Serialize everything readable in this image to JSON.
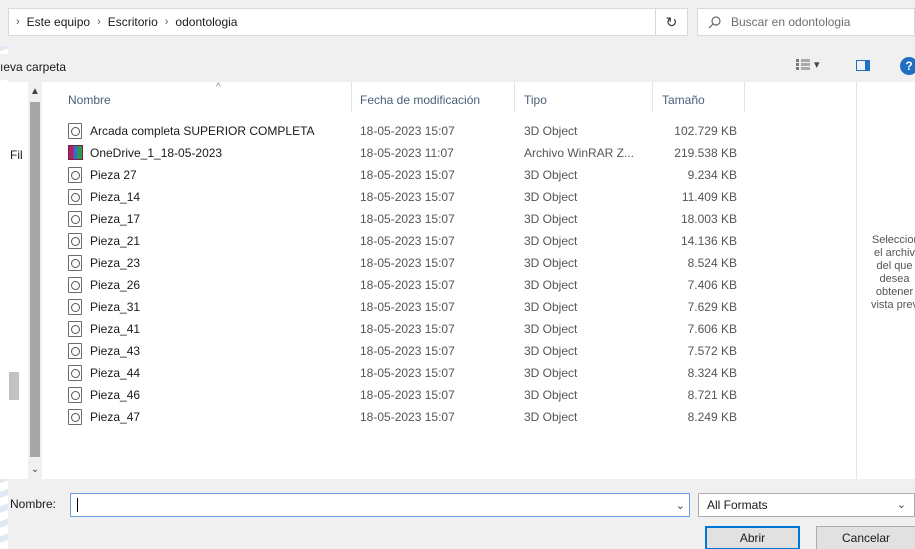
{
  "address": {
    "crumbs": [
      "Este equipo",
      "Escritorio",
      "odontologia"
    ],
    "dropdown_icon": "chevron-down-icon",
    "refresh_icon": "refresh-icon"
  },
  "search": {
    "placeholder": "Buscar en odontologia"
  },
  "toolbar": {
    "new_folder_label": "ıeva carpeta",
    "view_icon": "view-options-icon",
    "preview_icon": "preview-pane-icon",
    "help_label": "?"
  },
  "nav": {
    "label": "Fil"
  },
  "columns": {
    "name": "Nombre",
    "date": "Fecha de modificación",
    "type": "Tipo",
    "size": "Tamaño"
  },
  "files": [
    {
      "name": "Arcada completa SUPERIOR COMPLETA",
      "date": "18-05-2023 15:07",
      "type": "3D Object",
      "size": "102.729 KB",
      "icon": "3d-object-icon"
    },
    {
      "name": "OneDrive_1_18-05-2023",
      "date": "18-05-2023 11:07",
      "type": "Archivo WinRAR Z...",
      "size": "219.538 KB",
      "icon": "winrar-icon"
    },
    {
      "name": "Pieza 27",
      "date": "18-05-2023 15:07",
      "type": "3D Object",
      "size": "9.234 KB",
      "icon": "3d-object-icon"
    },
    {
      "name": "Pieza_14",
      "date": "18-05-2023 15:07",
      "type": "3D Object",
      "size": "11.409 KB",
      "icon": "3d-object-icon"
    },
    {
      "name": "Pieza_17",
      "date": "18-05-2023 15:07",
      "type": "3D Object",
      "size": "18.003 KB",
      "icon": "3d-object-icon"
    },
    {
      "name": "Pieza_21",
      "date": "18-05-2023 15:07",
      "type": "3D Object",
      "size": "14.136 KB",
      "icon": "3d-object-icon"
    },
    {
      "name": "Pieza_23",
      "date": "18-05-2023 15:07",
      "type": "3D Object",
      "size": "8.524 KB",
      "icon": "3d-object-icon"
    },
    {
      "name": "Pieza_26",
      "date": "18-05-2023 15:07",
      "type": "3D Object",
      "size": "7.406 KB",
      "icon": "3d-object-icon"
    },
    {
      "name": "Pieza_31",
      "date": "18-05-2023 15:07",
      "type": "3D Object",
      "size": "7.629 KB",
      "icon": "3d-object-icon"
    },
    {
      "name": "Pieza_41",
      "date": "18-05-2023 15:07",
      "type": "3D Object",
      "size": "7.606 KB",
      "icon": "3d-object-icon"
    },
    {
      "name": "Pieza_43",
      "date": "18-05-2023 15:07",
      "type": "3D Object",
      "size": "7.572 KB",
      "icon": "3d-object-icon"
    },
    {
      "name": "Pieza_44",
      "date": "18-05-2023 15:07",
      "type": "3D Object",
      "size": "8.324 KB",
      "icon": "3d-object-icon"
    },
    {
      "name": "Pieza_46",
      "date": "18-05-2023 15:07",
      "type": "3D Object",
      "size": "8.721 KB",
      "icon": "3d-object-icon"
    },
    {
      "name": "Pieza_47",
      "date": "18-05-2023 15:07",
      "type": "3D Object",
      "size": "8.249 KB",
      "icon": "3d-object-icon"
    }
  ],
  "preview": {
    "lines": [
      "Seleccior",
      "el archiv",
      "del que",
      "desea",
      "obtener",
      "vista prev"
    ]
  },
  "footer": {
    "name_label": "Nombre:",
    "name_value": "",
    "format_selected": "All Formats",
    "open_label": "Abrir",
    "cancel_label": "Cancelar"
  }
}
